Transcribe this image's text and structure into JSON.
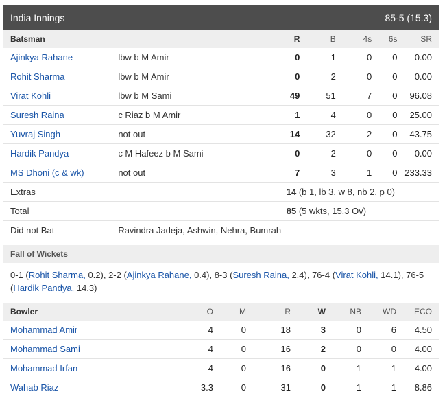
{
  "innings": {
    "title": "India Innings",
    "score": "85-5 (15.3)"
  },
  "batting": {
    "headers": {
      "batsman": "Batsman",
      "r": "R",
      "b": "B",
      "fours": "4s",
      "sixes": "6s",
      "sr": "SR"
    },
    "rows": [
      {
        "name": "Ajinkya Rahane",
        "dismissal": "lbw b M Amir",
        "r": "0",
        "b": "1",
        "fours": "0",
        "sixes": "0",
        "sr": "0.00"
      },
      {
        "name": "Rohit Sharma",
        "dismissal": "lbw b M Amir",
        "r": "0",
        "b": "2",
        "fours": "0",
        "sixes": "0",
        "sr": "0.00"
      },
      {
        "name": "Virat Kohli",
        "dismissal": "lbw b M Sami",
        "r": "49",
        "b": "51",
        "fours": "7",
        "sixes": "0",
        "sr": "96.08"
      },
      {
        "name": "Suresh Raina",
        "dismissal": "c Riaz b M Amir",
        "r": "1",
        "b": "4",
        "fours": "0",
        "sixes": "0",
        "sr": "25.00"
      },
      {
        "name": "Yuvraj Singh",
        "dismissal": "not out",
        "r": "14",
        "b": "32",
        "fours": "2",
        "sixes": "0",
        "sr": "43.75"
      },
      {
        "name": "Hardik Pandya",
        "dismissal": "c M Hafeez b M Sami",
        "r": "0",
        "b": "2",
        "fours": "0",
        "sixes": "0",
        "sr": "0.00"
      },
      {
        "name": "MS Dhoni (c & wk)",
        "dismissal": "not out",
        "r": "7",
        "b": "3",
        "fours": "1",
        "sixes": "0",
        "sr": "233.33"
      }
    ],
    "extras": {
      "label": "Extras",
      "value": "14",
      "detail": "(b 1, lb 3, w 8, nb 2, p 0)"
    },
    "total": {
      "label": "Total",
      "value": "85",
      "detail": "(5 wkts, 15.3 Ov)"
    },
    "did_not_bat": {
      "label": "Did not Bat",
      "value": "Ravindra Jadeja, Ashwin, Nehra, Bumrah"
    }
  },
  "fall_of_wickets": {
    "title": "Fall of Wickets",
    "segments": [
      {
        "text": "0-1 (",
        "link": false
      },
      {
        "text": "Rohit Sharma,",
        "link": true
      },
      {
        "text": " 0.2), 2-2 (",
        "link": false
      },
      {
        "text": "Ajinkya Rahane,",
        "link": true
      },
      {
        "text": " 0.4), 8-3 (",
        "link": false
      },
      {
        "text": "Suresh Raina,",
        "link": true
      },
      {
        "text": " 2.4), 76-4 (",
        "link": false
      },
      {
        "text": "Virat Kohli,",
        "link": true
      },
      {
        "text": " 14.1), 76-5 (",
        "link": false
      },
      {
        "text": "Hardik Pandya,",
        "link": true
      },
      {
        "text": " 14.3)",
        "link": false
      }
    ]
  },
  "bowling": {
    "headers": {
      "bowler": "Bowler",
      "o": "O",
      "m": "M",
      "r": "R",
      "w": "W",
      "nb": "NB",
      "wd": "WD",
      "eco": "ECO"
    },
    "rows": [
      {
        "name": "Mohammad Amir",
        "o": "4",
        "m": "0",
        "r": "18",
        "w": "3",
        "nb": "0",
        "wd": "6",
        "eco": "4.50"
      },
      {
        "name": "Mohammad Sami",
        "o": "4",
        "m": "0",
        "r": "16",
        "w": "2",
        "nb": "0",
        "wd": "0",
        "eco": "4.00"
      },
      {
        "name": "Mohammad Irfan",
        "o": "4",
        "m": "0",
        "r": "16",
        "w": "0",
        "nb": "1",
        "wd": "1",
        "eco": "4.00"
      },
      {
        "name": "Wahab Riaz",
        "o": "3.3",
        "m": "0",
        "r": "31",
        "w": "0",
        "nb": "1",
        "wd": "1",
        "eco": "8.86"
      }
    ]
  }
}
